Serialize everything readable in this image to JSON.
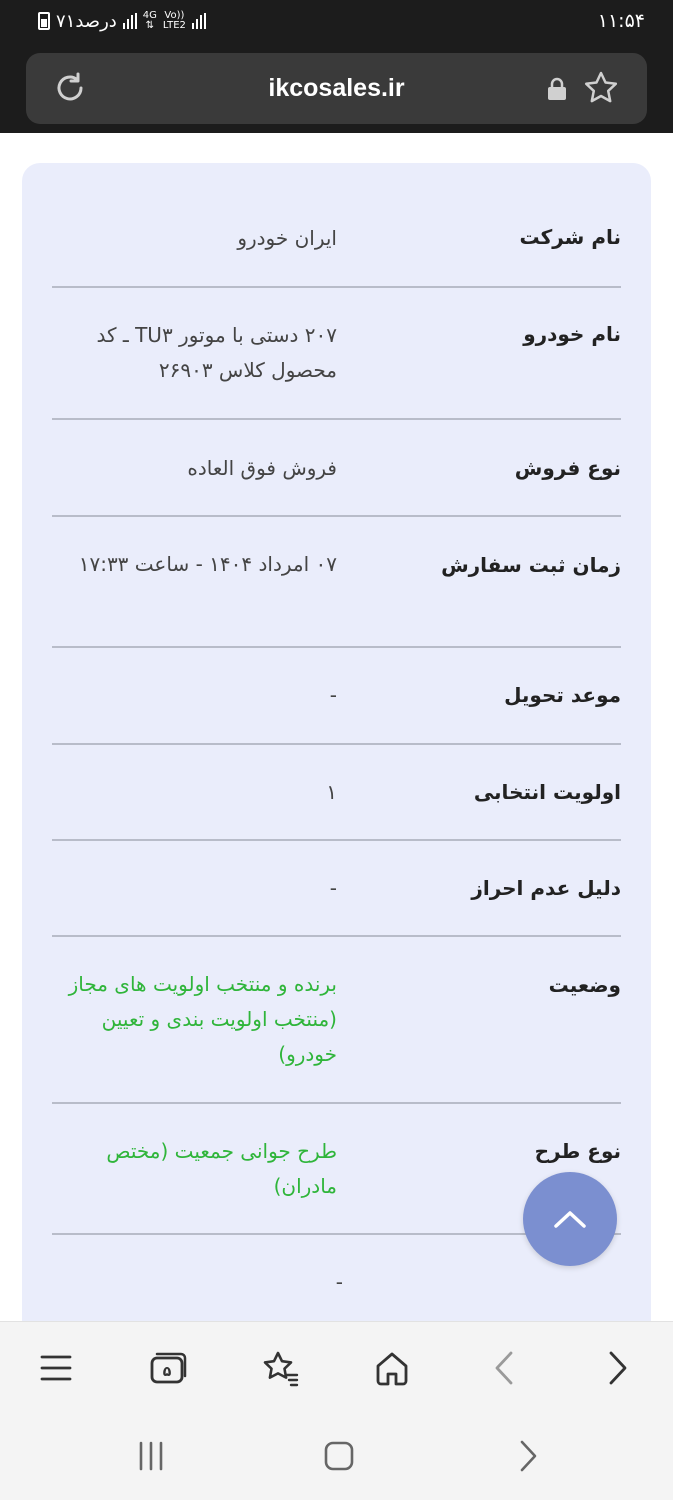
{
  "status_bar": {
    "time": "۱۱:۵۴",
    "battery": "۷۱درصد",
    "network_primary": "4G",
    "network_secondary": "LTE2",
    "volte": "Vo))"
  },
  "browser": {
    "url": "ikcosales.ir"
  },
  "details": [
    {
      "label": "نام شرکت",
      "value": "ایران خودرو",
      "value_color": "#444444"
    },
    {
      "label": "نام خودرو",
      "value": "۲۰۷ دستی با موتور TU۳ ـ کد محصول کلاس ۲۶۹۰۳",
      "value_color": "#444444"
    },
    {
      "label": "نوع فروش",
      "value": "فروش فوق العاده",
      "value_color": "#444444"
    },
    {
      "label": "زمان ثبت سفارش",
      "value": "۰۷ امرداد ۱۴۰۴ - ساعت ۱۷:۳۳",
      "value_color": "#444444"
    },
    {
      "label": "موعد تحویل",
      "value": "-",
      "value_color": "#444444"
    },
    {
      "label": "اولویت انتخابی",
      "value": "۱",
      "value_color": "#444444"
    },
    {
      "label": "دلیل عدم احراز",
      "value": "-",
      "value_color": "#444444"
    },
    {
      "label": "وضعیت",
      "value": "برنده و منتخب اولویت های مجاز (منتخب اولویت بندی و تعیین خودرو)",
      "value_color": "#2fb53a"
    },
    {
      "label": "نوع طرح",
      "value": "طرح جوانی جمعیت (مختص مادران)",
      "value_color": "#2fb53a"
    },
    {
      "label": "",
      "value": "-",
      "value_color": "#444444"
    }
  ],
  "icons": {
    "reload": "reload-icon",
    "lock": "lock-icon",
    "bookmark_star": "star-icon",
    "scroll_top": "chevron-up-icon",
    "toolbar": [
      "menu-icon",
      "tabs-icon",
      "bookmarks-icon",
      "home-icon",
      "back-icon",
      "forward-icon"
    ],
    "tabs_count": "۵",
    "navigation": [
      "recents-icon",
      "home-nav-icon",
      "back-nav-icon"
    ]
  },
  "colors": {
    "card_background": "#eaedfb",
    "status_green": "#2fb53a",
    "fab": "#7b8fd0",
    "browser_dark": "#1c1c1c"
  }
}
